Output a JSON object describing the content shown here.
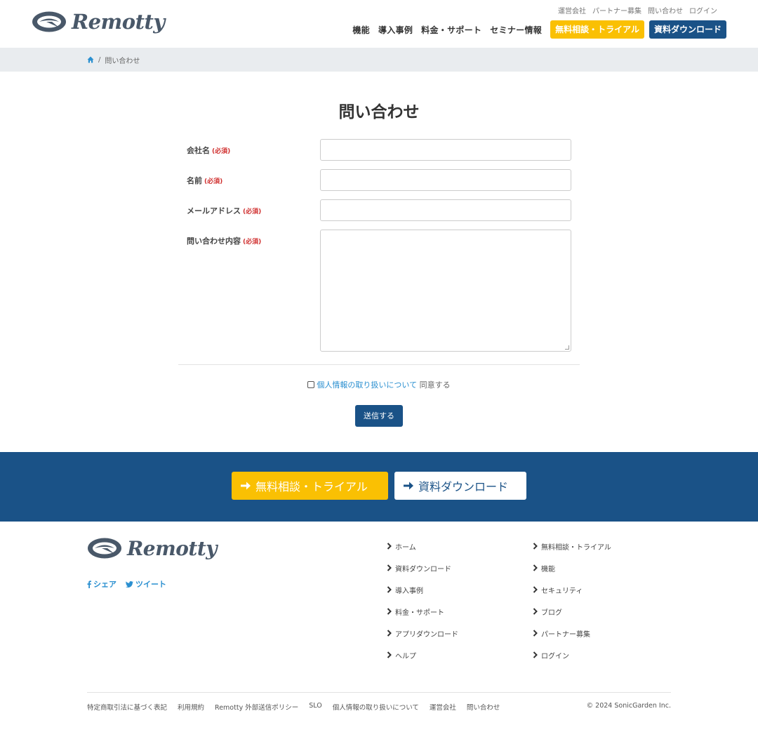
{
  "header": {
    "logo_text": "Remotty",
    "util_links": [
      "運営会社",
      "パートナー募集",
      "問い合わせ",
      "ログイン"
    ],
    "nav_links": [
      "機能",
      "導入事例",
      "料金・サポート",
      "セミナー情報"
    ],
    "trial_button": "無料相談・トライアル",
    "download_button": "資料ダウンロード"
  },
  "breadcrumb": {
    "current": "問い合わせ"
  },
  "page_title": "問い合わせ",
  "form": {
    "required_mark": "(必須)",
    "fields": [
      {
        "label": "会社名",
        "value": ""
      },
      {
        "label": "名前",
        "value": ""
      },
      {
        "label": "メールアドレス",
        "value": ""
      },
      {
        "label": "問い合わせ内容",
        "value": ""
      }
    ],
    "privacy_link": "個人情報の取り扱いについて",
    "agree_text": "同意する",
    "submit_label": "送信する"
  },
  "cta": {
    "trial": "無料相談・トライアル",
    "download": "資料ダウンロード"
  },
  "footer": {
    "logo_text": "Remotty",
    "share_label": "シェア",
    "tweet_label": "ツイート",
    "col1": [
      "ホーム",
      "資料ダウンロード",
      "導入事例",
      "料金・サポート",
      "アプリダウンロード",
      "ヘルプ"
    ],
    "col2": [
      "無料相談・トライアル",
      "機能",
      "セキュリティ",
      "ブログ",
      "パートナー募集",
      "ログイン"
    ],
    "bottom_links": [
      "特定商取引法に基づく表記",
      "利用規約",
      "Remotty 外部送信ポリシー",
      "SLO",
      "個人情報の取り扱いについて",
      "運営会社",
      "問い合わせ"
    ],
    "copyright": "© 2024 SonicGarden Inc."
  },
  "colors": {
    "brand_navy": "#1a5287",
    "brand_yellow": "#fac003",
    "link_blue": "#2a8fd0",
    "required_red": "#d0302f"
  },
  "icons": [
    "remotty-logo-icon",
    "home-icon",
    "arrow-right-icon",
    "facebook-icon",
    "twitter-icon",
    "chevron-right-icon"
  ]
}
